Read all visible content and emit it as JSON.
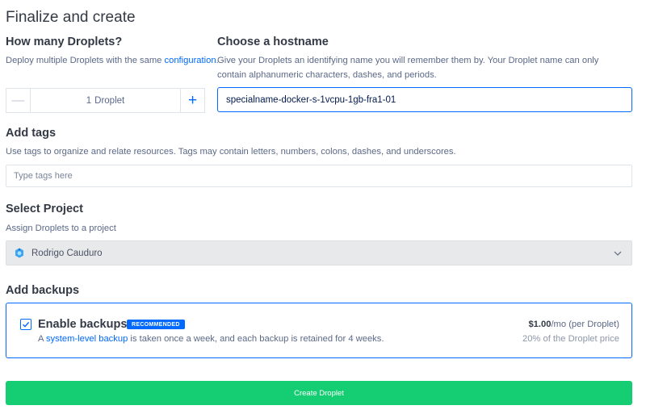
{
  "page": {
    "title": "Finalize and create"
  },
  "droplets": {
    "heading": "How many Droplets?",
    "desc_prefix": "Deploy multiple Droplets with the same ",
    "desc_link": "configuration",
    "desc_suffix": ".",
    "minus": "—",
    "plus": "+",
    "count": "1",
    "unit": "Droplet"
  },
  "hostname": {
    "heading": "Choose a hostname",
    "desc": "Give your Droplets an identifying name you will remember them by. Your Droplet name can only contain alphanumeric characters, dashes, and periods.",
    "value": "specialname-docker-s-1vcpu-1gb-fra1-01"
  },
  "tags": {
    "heading": "Add tags",
    "desc": "Use tags to organize and relate resources. Tags may contain letters, numbers, colons, dashes, and underscores.",
    "placeholder": "Type tags here"
  },
  "project": {
    "heading": "Select Project",
    "desc": "Assign Droplets to a project",
    "selected": "Rodrigo Cauduro"
  },
  "backups": {
    "heading": "Add backups",
    "title": "Enable backups",
    "badge": "RECOMMENDED",
    "desc_prefix": "A ",
    "desc_link": "system-level backup",
    "desc_suffix": " is taken once a week, and each backup is retained for 4 weeks.",
    "price": "$1.00",
    "price_suffix": "/mo (per Droplet)",
    "price_sub": "20% of the Droplet price",
    "checked": true
  },
  "create": {
    "label": "Create Droplet"
  },
  "icons": {
    "avatar": "project-avatar-icon",
    "chevron": "chevron-down-icon",
    "check": "check-icon"
  },
  "colors": {
    "accent": "#0069ff",
    "create": "#15cd72",
    "text": "#333a45",
    "muted": "#5b6987"
  }
}
